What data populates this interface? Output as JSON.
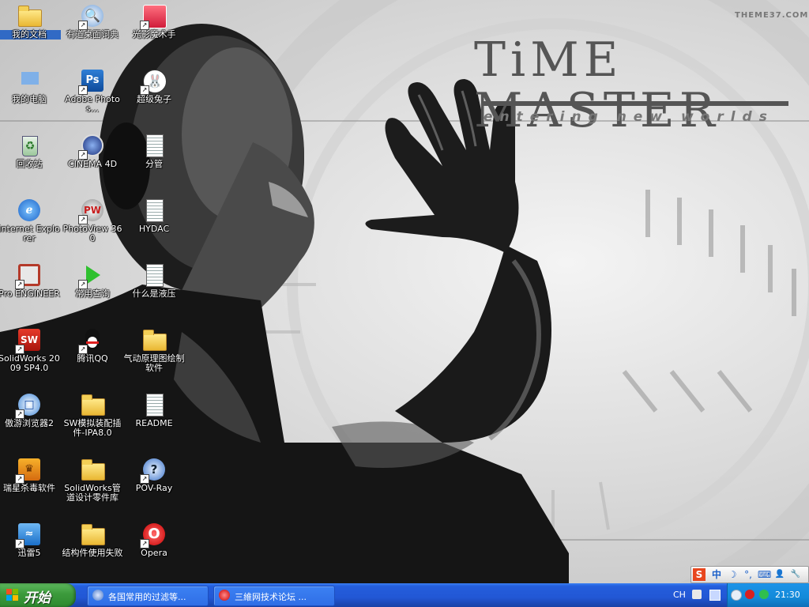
{
  "wallpaper": {
    "title": "TiME MASTER",
    "subtitle": "entering new worlds",
    "mark": "THEME37.COM"
  },
  "icons": [
    {
      "label": "我的文档",
      "icon": "my-documents-icon",
      "shortcut": false,
      "selected": true
    },
    {
      "label": "有道桌面词典",
      "icon": "youdao-dictionary-icon",
      "shortcut": true
    },
    {
      "label": "光影魔术手",
      "icon": "nikon-photo-icon",
      "shortcut": true
    },
    {
      "label": "我的电脑",
      "icon": "my-computer-icon",
      "shortcut": false
    },
    {
      "label": "Adobe Photos...",
      "icon": "photoshop-icon",
      "shortcut": true
    },
    {
      "label": "超级兔子",
      "icon": "rabbit-icon",
      "shortcut": true
    },
    {
      "label": "回收站",
      "icon": "recycle-bin-icon",
      "shortcut": false
    },
    {
      "label": "CINEMA 4D",
      "icon": "cinema4d-icon",
      "shortcut": true
    },
    {
      "label": "分管",
      "icon": "text-document-icon",
      "shortcut": false
    },
    {
      "label": "Internet Explorer",
      "icon": "internet-explorer-icon",
      "shortcut": false
    },
    {
      "label": "PhotoView 360",
      "icon": "photoview-icon",
      "shortcut": true
    },
    {
      "label": "HYDAC",
      "icon": "text-document-icon",
      "shortcut": false
    },
    {
      "label": "Pro ENGINEER",
      "icon": "proengineer-icon",
      "shortcut": true
    },
    {
      "label": "常用查询",
      "icon": "green-arrow-icon",
      "shortcut": true
    },
    {
      "label": "什么是液压",
      "icon": "text-document-icon",
      "shortcut": false
    },
    {
      "label": "SolidWorks 2009 SP4.0",
      "icon": "solidworks-icon",
      "shortcut": true
    },
    {
      "label": "腾讯QQ",
      "icon": "qq-penguin-icon",
      "shortcut": true
    },
    {
      "label": "气动原理图绘制软件",
      "icon": "folder-icon",
      "shortcut": false
    },
    {
      "label": "傲游浏览器2",
      "icon": "maxthon-icon",
      "shortcut": true
    },
    {
      "label": "SW模拟装配插件-IPA8.0",
      "icon": "folder-icon",
      "shortcut": false
    },
    {
      "label": "README",
      "icon": "text-document-icon",
      "shortcut": false
    },
    {
      "label": "瑞星杀毒软件",
      "icon": "rising-lion-icon",
      "shortcut": true
    },
    {
      "label": "SolidWorks管道设计零件库",
      "icon": "folder-icon",
      "shortcut": false
    },
    {
      "label": "POV-Ray",
      "icon": "povray-icon",
      "shortcut": true
    },
    {
      "label": "迅雷5",
      "icon": "thunder-icon",
      "shortcut": true
    },
    {
      "label": "结构件使用失败",
      "icon": "folder-icon",
      "shortcut": false
    },
    {
      "label": "Opera",
      "icon": "opera-icon",
      "shortcut": true
    }
  ],
  "ime_bar": [
    "S",
    "中",
    "☽",
    "°,",
    "⌨",
    "👤",
    "🔧"
  ],
  "taskbar": {
    "start_label": "开始",
    "tasks": [
      {
        "label": "各国常用的过滤等...",
        "icon": "ie-window-icon"
      },
      {
        "label": "三維网技术论坛 ...",
        "icon": "opera-window-icon"
      }
    ],
    "language": "CH",
    "clock": "21:30"
  }
}
